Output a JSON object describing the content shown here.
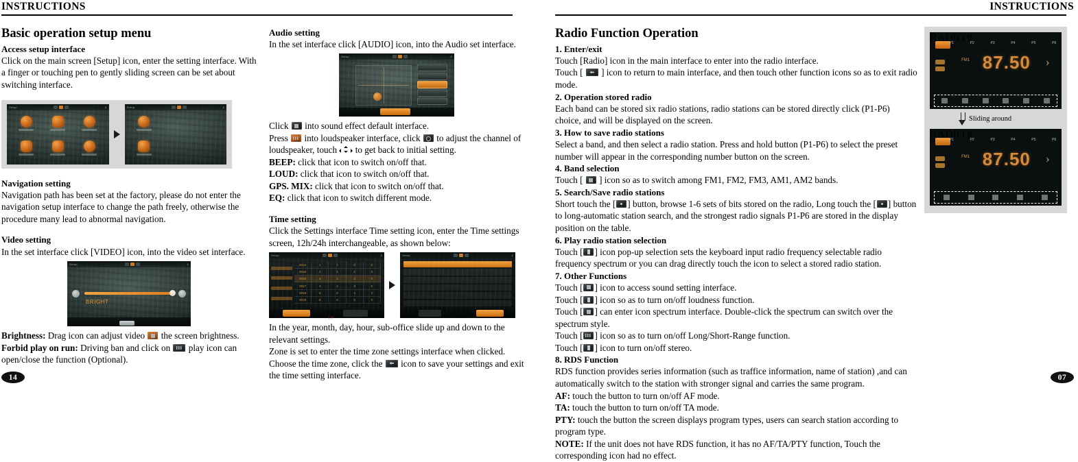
{
  "left_page": {
    "running_head": "INSTRUCTIONS",
    "page_number": "14",
    "col1": {
      "heading": "Basic operation setup menu",
      "access_title": "Access setup interface",
      "access_body": "Click on the main screen [Setup] icon, enter the setting interface. With a finger or touching pen to gently sliding screen can be set about switching interface.",
      "nav_title": "Navigation setting",
      "nav_body": "Navigation path has been set at the factory, please do not enter the  navigation setup interface to change the path freely, otherwise the procedure many lead to abnormal navigation.",
      "video_title": "Video setting",
      "video_body": "In the set interface click [VIDEO] icon, into the video set interface.",
      "brightness_label": "Brightness:",
      "brightness_text_a": " Drag icon can adjust video ",
      "brightness_text_b": " the screen brightness.",
      "forbid_label": "Forbid play on run:",
      "forbid_text_a": " Driving ban and click on ",
      "forbid_text_b": " play icon can open/close the function (Optional)."
    },
    "col2": {
      "audio_title": "Audio setting",
      "audio_body": "In the set interface click [AUDIO] icon, into the Audio set interface.",
      "click_line_a": "Click ",
      "click_line_b": " into sound effect default interface.",
      "press_line_a": "Press ",
      "press_line_b": " into loudspeaker interface, click ",
      "press_line_c": " to adjust the channel of loudspeaker, touch ",
      "press_line_d": " to get back to initial setting.",
      "beep_label": "BEEP:",
      "beep_text": " click that icon to switch on/off that.",
      "loud_label": "LOUD:",
      "loud_text": " click that icon to switch on/off that.",
      "gpsmix_label": "GPS. MIX:",
      "gpsmix_text": " click that icon to switch on/off that.",
      "eq_label": "EQ:",
      "eq_text": " click that icon to switch different mode.",
      "time_title": "Time setting",
      "time_body": "Click the Settings interface Time setting icon, enter the Time settings screen, 12h/24h interchangeable, as shown below:",
      "time_after_1": "In the year, month, day, hour, sub-office slide up and down to the relevant settings.",
      "time_after_2": "Zone is set to enter the time zone settings interface when clicked.",
      "time_after_3a": "Choose the time zone, click the ",
      "time_after_3b": " icon to save your settings and exit the time setting interface."
    }
  },
  "right_page": {
    "running_head": "INSTRUCTIONS",
    "page_number": "07",
    "heading": "Radio Function Operation",
    "items": {
      "s1_title": "1. Enter/exit",
      "s1_l1": "Touch [Radio] icon in the main interface to enter into the radio interface.",
      "s1_l2a": "Touch [ ",
      "s1_l2b": " ] icon to return to main interface, and then touch other function icons so as to exit radio mode.",
      "s2_title": "2. Operation stored radio",
      "s2_body": "Each band can be stored six radio stations, radio stations can be stored directly click (P1-P6) choice, and will be displayed on the screen.",
      "s3_title": "3. How to save radio stations",
      "s3_body": "Select a band, and then select a radio station. Press and hold button (P1-P6) to select the preset number will appear in the corresponding number button on the screen.",
      "s4_title": "4. Band selection",
      "s4_a": "Touch [ ",
      "s4_b": " ] icon so as to switch among FM1, FM2, FM3, AM1, AM2 bands.",
      "s5_title": "5. Search/Save radio stations",
      "s5_a": "Short touch the [",
      "s5_b": "] button, browse 1-6 sets of bits stored on the radio, Long touch the [",
      "s5_c": "] button to long-automatic station search, and the strongest radio signals P1-P6 are stored in the display position on the table.",
      "s6_title": "6. Play radio station selection",
      "s6_a": "Touch [",
      "s6_b": "] icon pop-up selection sets the keyboard input radio frequency selectable radio frequency spectrum or you can drag directly touch the icon to select a stored radio station.",
      "s7_title": "7. Other Functions",
      "s7_1a": "Touch [",
      "s7_1b": "] icon to access sound setting interface.",
      "s7_2b": "] icon so as to turn on/off loudness function.",
      "s7_3b": "] can enter icon spectrum interface. Double-click the spectrum can switch over the spectrum style.",
      "s7_4b": "] icon so as to turn on/off Long/Short-Range function.",
      "s7_5b": "] icon to turn on/off stereo.",
      "s8_title": "8. RDS Function",
      "s8_body": "RDS function provides series information (such as traffice information, name of station) ,and can automatically switch to the station with stronger signal and carries the same program.",
      "af_label": "AF:",
      "af_text": " touch the button to turn on/off AF mode.",
      "ta_label": "TA:",
      "ta_text": " touch the button to turn on/off TA mode.",
      "pty_label": "PTY:",
      "pty_text": " touch the button the screen displays program types, users can search station according to program type.",
      "note_label": "NOTE:",
      "note_text": " If the unit does not have RDS function, it has no AF/TA/PTY function, Touch the corresponding icon had no effect."
    },
    "figure": {
      "caption": "Sliding around",
      "screen_label": "RADIO",
      "frequency": "87.50",
      "band": "FM1",
      "presets": [
        "P1",
        "P2",
        "P3",
        "P4",
        "P5",
        "P6"
      ]
    }
  },
  "left_figures": {
    "setup_screen_label": "Setup",
    "video_screen_label": "Setup",
    "audio_screen_label": "Setup",
    "time_screen_label": "Setup",
    "brightness_value": "BRIGHT"
  },
  "colors": {
    "accent_orange": "#e1902f",
    "figure_bg": "#d7d7d7",
    "cursor_red": "#d4261f",
    "ink": "#000000"
  }
}
